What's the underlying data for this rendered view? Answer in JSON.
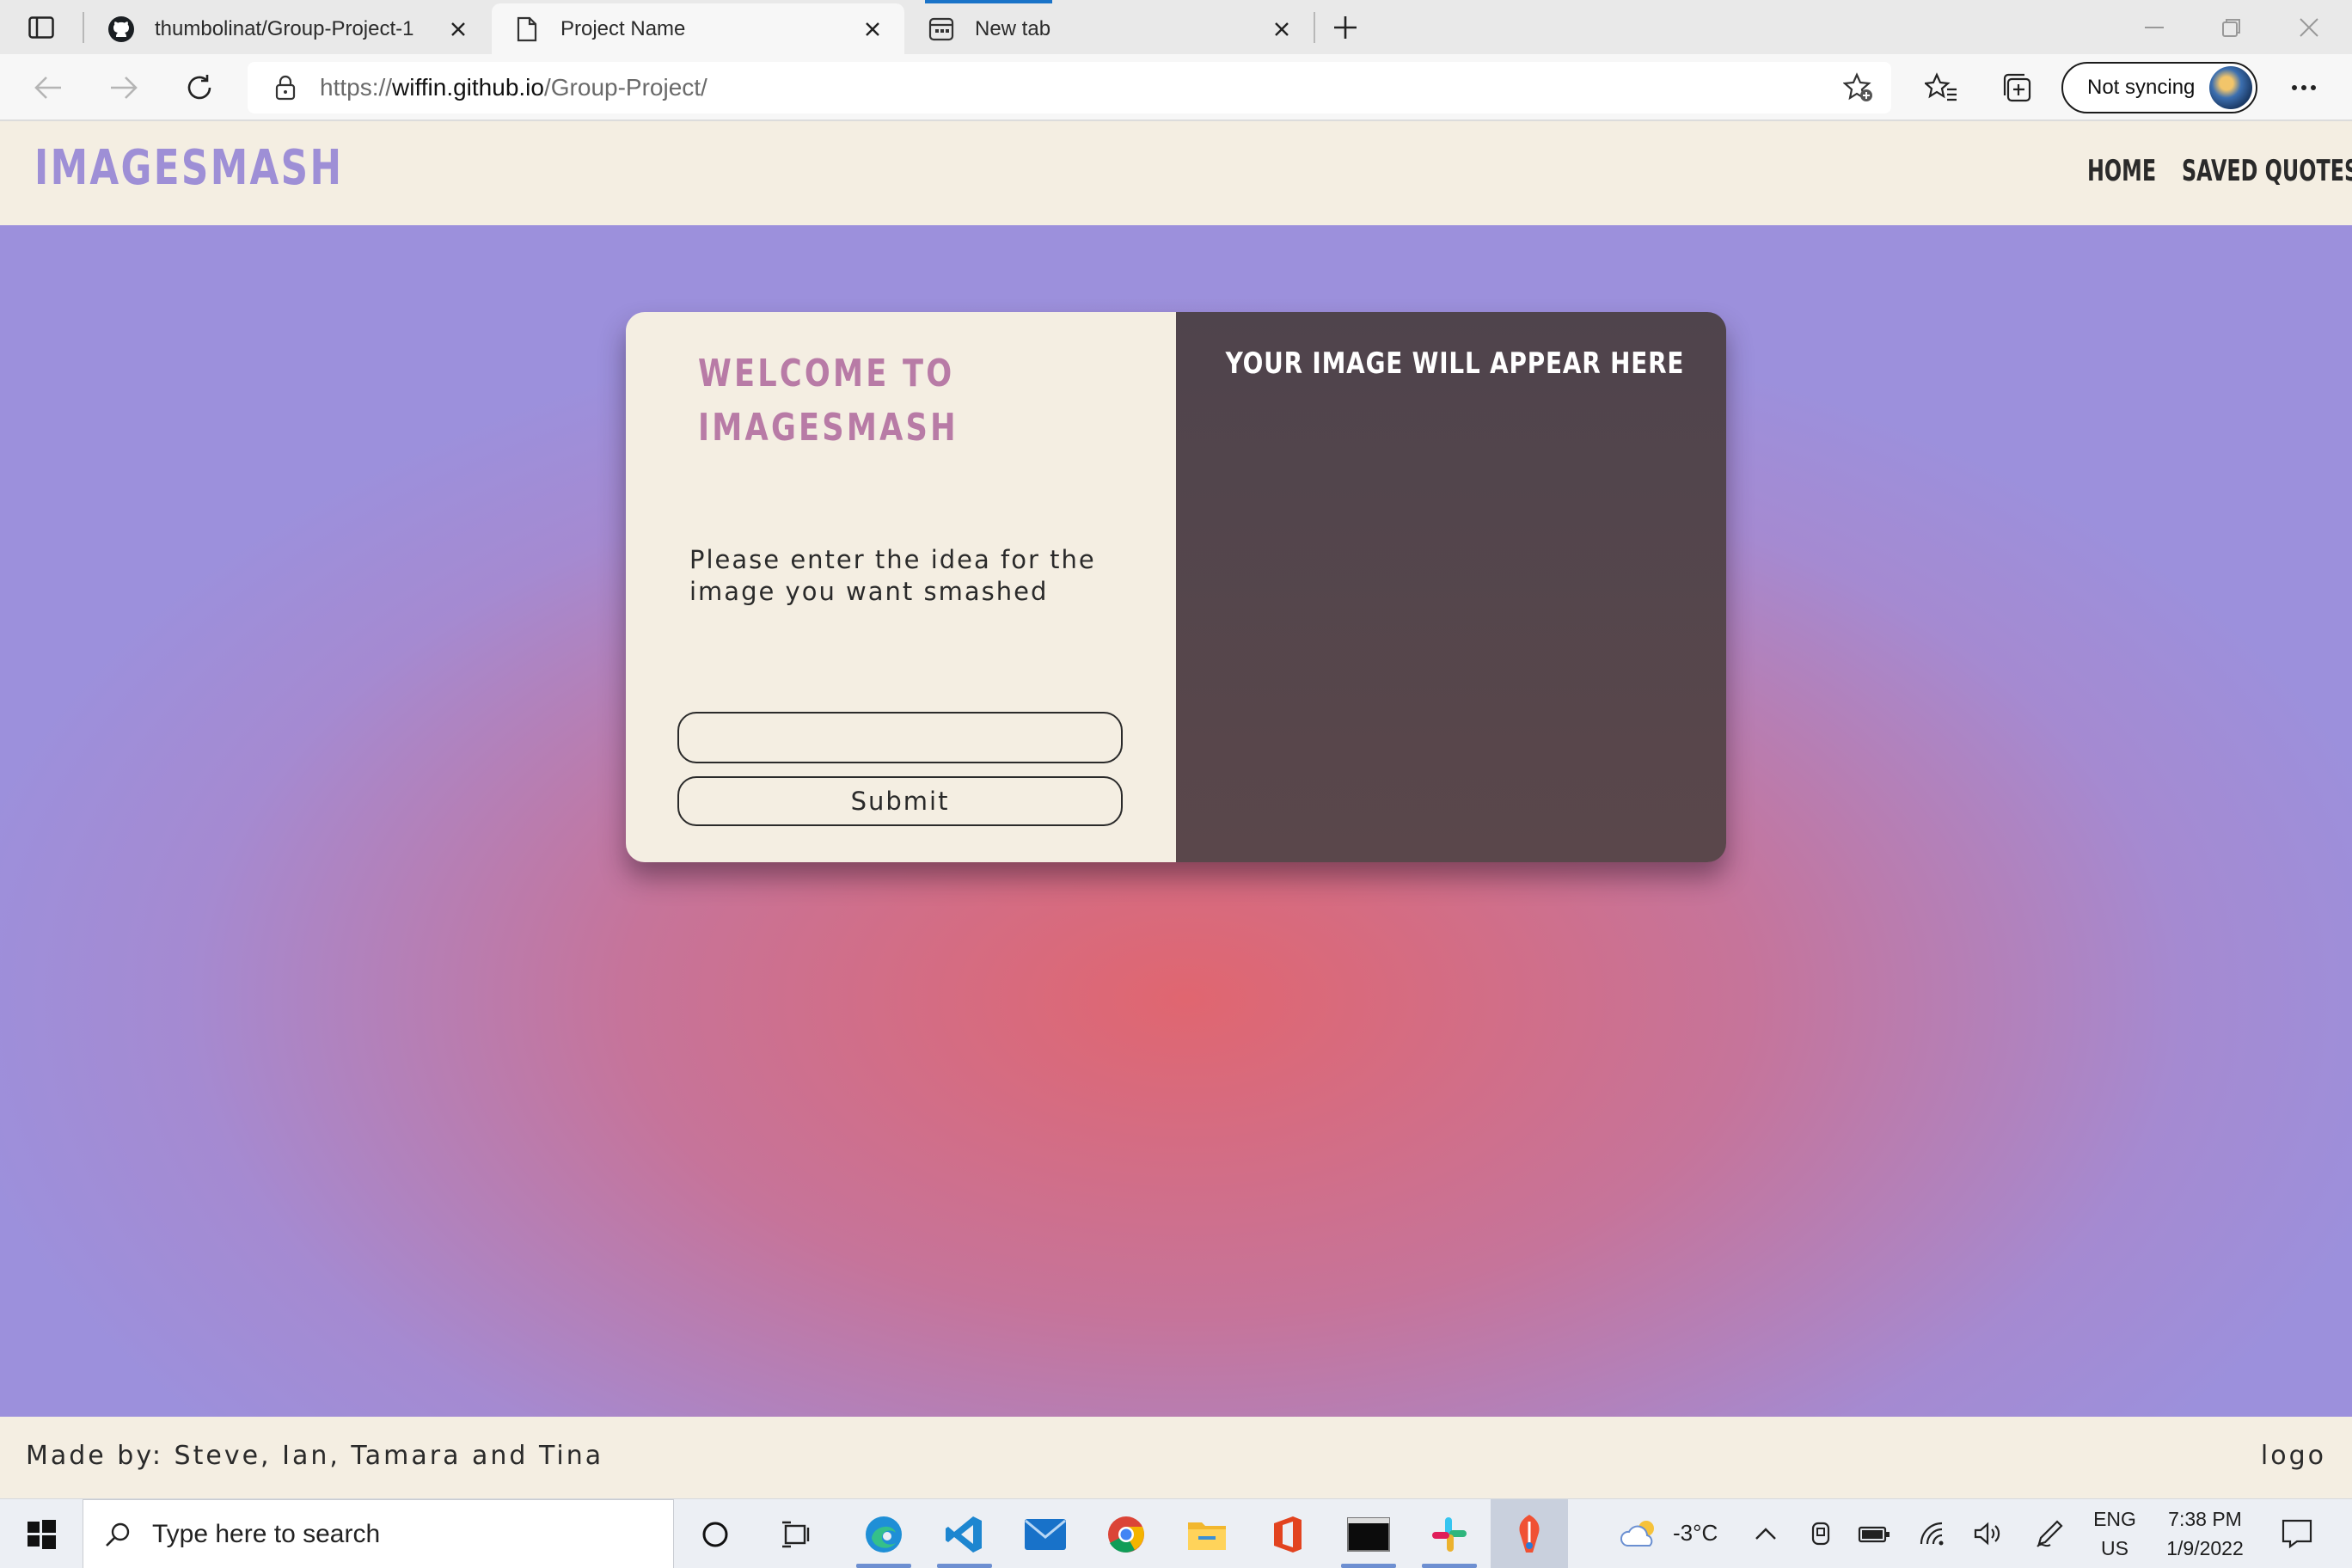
{
  "browser": {
    "tabs": [
      {
        "title": "thumbolinat/Group-Project-1",
        "icon": "github-icon"
      },
      {
        "title": "Project Name",
        "icon": "page-icon",
        "active": true
      },
      {
        "title": "New tab",
        "icon": "newtab-icon"
      }
    ],
    "address": {
      "scheme": "https://",
      "host": "wiffin.github.io",
      "path": "/Group-Project/"
    },
    "sync_label": "Not syncing"
  },
  "site": {
    "logo": "IMAGESMASH",
    "nav": {
      "home": "HOME",
      "saved_quotes": "SAVED QUOTES"
    },
    "colors": {
      "logo": "#9e8fd6",
      "welcome": "#b87ba6",
      "header_bg": "#f4eee2",
      "dark_panel": "#54474c"
    },
    "card": {
      "welcome_title": "WELCOME TO\nIMAGESMASH",
      "prompt": "Please enter the idea for the image you want smashed",
      "input_value": "",
      "submit_label": "Submit",
      "image_placeholder": "YOUR IMAGE WILL APPEAR HERE"
    },
    "footer": {
      "credits": "Made by: Steve, Ian, Tamara and Tina",
      "logo": "logo"
    }
  },
  "taskbar": {
    "search_placeholder": "Type here to search",
    "weather": "-3°C",
    "language": "ENG",
    "region": "US",
    "time": "7:38 PM",
    "date": "1/9/2022",
    "apps": [
      "cortana-icon",
      "task-view-icon",
      "edge-icon",
      "vscode-icon",
      "mail-icon",
      "chrome-icon",
      "file-explorer-icon",
      "office-icon",
      "terminal-icon",
      "slack-icon",
      "git-app-icon"
    ]
  }
}
